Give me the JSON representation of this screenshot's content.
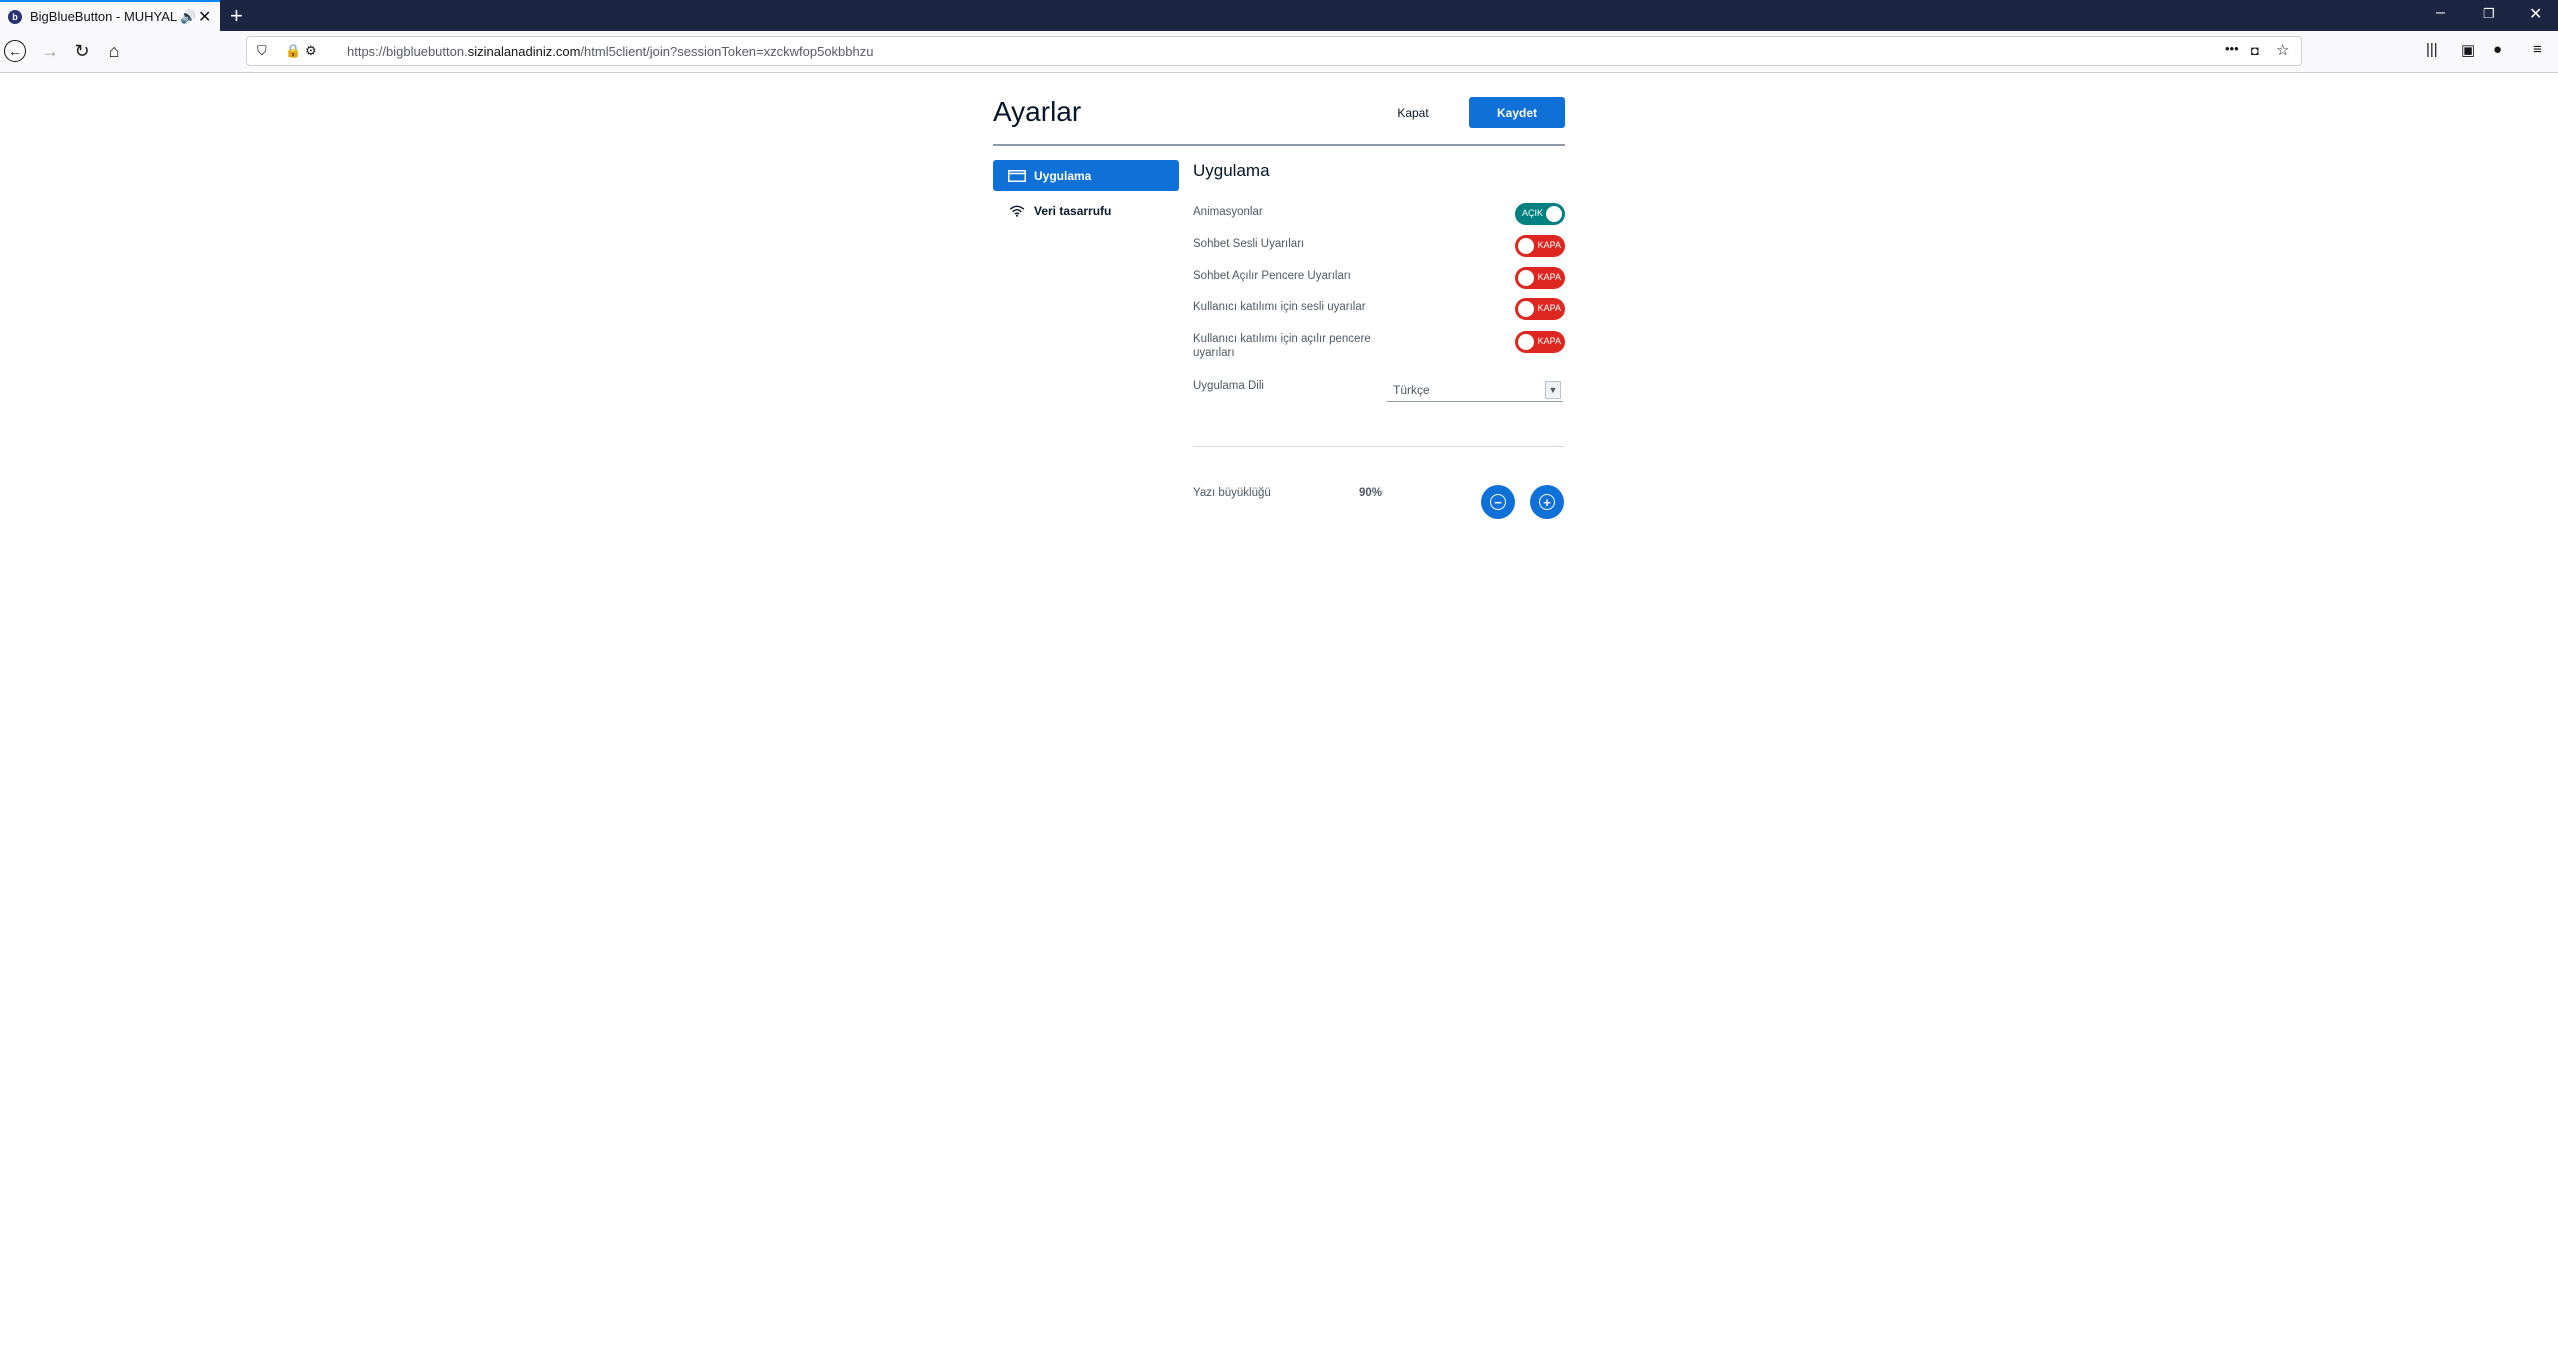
{
  "browser": {
    "tab_title": "BigBlueButton - MUHYAL",
    "favicon_icon": "bigbluebutton-logo-icon",
    "url_prefix": "https://bigbluebutton.",
    "url_domain": "sizinalanadiniz.com",
    "url_suffix": "/html5client/join?sessionToken=xzckwfop5okbbhzu"
  },
  "dialog": {
    "title": "Ayarlar",
    "close_label": "Kapat",
    "save_label": "Kaydet"
  },
  "sidebar": {
    "items": [
      {
        "label": "Uygulama",
        "icon": "application-window-icon",
        "active": true
      },
      {
        "label": "Veri tasarrufu",
        "icon": "wifi-icon",
        "active": false
      }
    ]
  },
  "app_settings": {
    "section_title": "Uygulama",
    "rows": [
      {
        "label": "Animasyonlar",
        "state": "on",
        "state_label": "AÇIK"
      },
      {
        "label": "Sohbet Sesli Uyarıları",
        "state": "off",
        "state_label": "KAPA"
      },
      {
        "label": "Sohbet Açılır Pencere Uyarıları",
        "state": "off",
        "state_label": "KAPA"
      },
      {
        "label": "Kullanıcı katılımı için sesli uyarılar",
        "state": "off",
        "state_label": "KAPA"
      },
      {
        "label": "Kullanıcı katılımı için açılır pencere uyarıları",
        "state": "off",
        "state_label": "KAPA"
      }
    ],
    "language_label": "Uygulama Dili",
    "language_value": "Türkçe",
    "font_size_label": "Yazı büyüklüğü",
    "font_size_value": "90%"
  },
  "colors": {
    "primary": "#0f70d7",
    "toggle_on": "#008081",
    "toggle_off": "#de2721",
    "tabbar": "#1c2541"
  }
}
